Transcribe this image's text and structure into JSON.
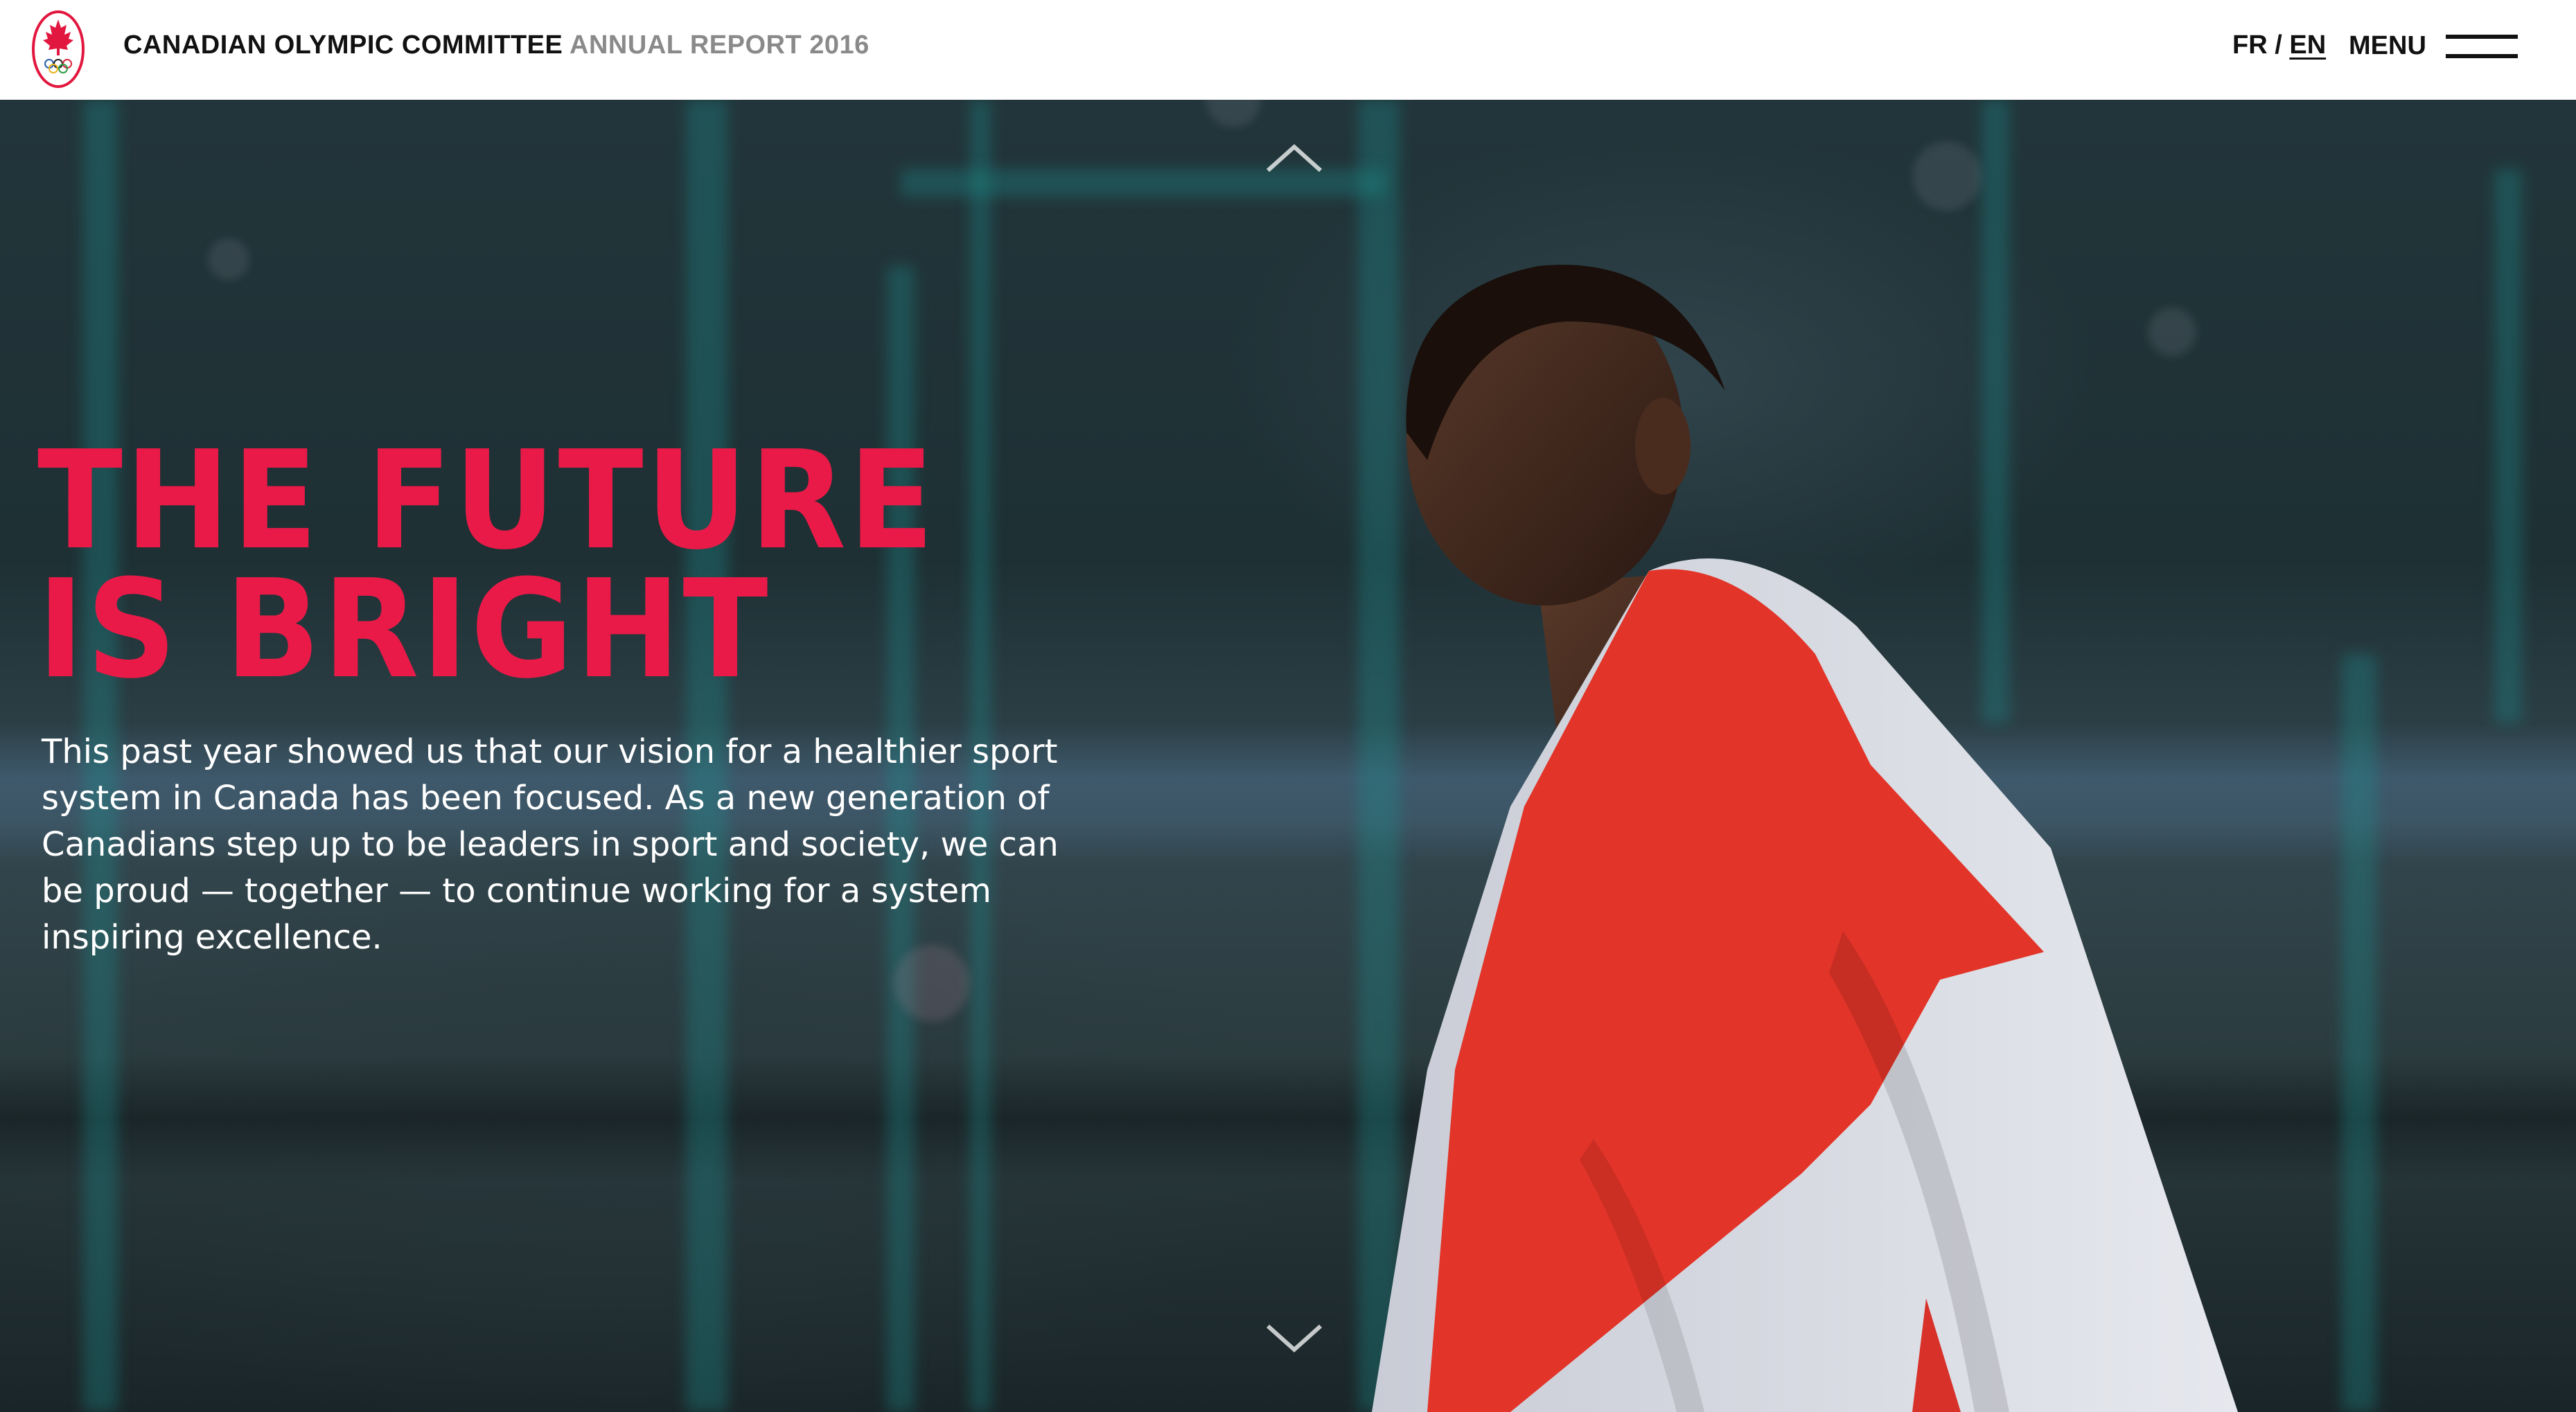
{
  "header": {
    "org_name": "CANADIAN OLYMPIC COMMITTEE",
    "report_name": "ANNUAL REPORT 2016",
    "lang_fr": "FR",
    "lang_separator": " / ",
    "lang_en": "EN",
    "menu_label": "MENU",
    "logo_icon": "maple-leaf-olympic-rings-logo",
    "menu_icon": "hamburger-icon"
  },
  "hero": {
    "headline_line1": "THE FUTURE",
    "headline_line2": "IS BRIGHT",
    "intro": "This past year showed us that our vision for a healthier sport system in Canada has been focused. As a new generation of Canadians step up to be leaders in sport and society, we can be proud — together — to continue working for a system inspiring excellence.",
    "scroll_up_icon": "chevron-up-icon",
    "scroll_down_icon": "chevron-down-icon"
  },
  "colors": {
    "accent_red": "#ea1a48",
    "header_bg": "#ffffff",
    "header_text": "#111111",
    "header_muted": "#8a8a8a",
    "intro_text": "#ffffff"
  }
}
